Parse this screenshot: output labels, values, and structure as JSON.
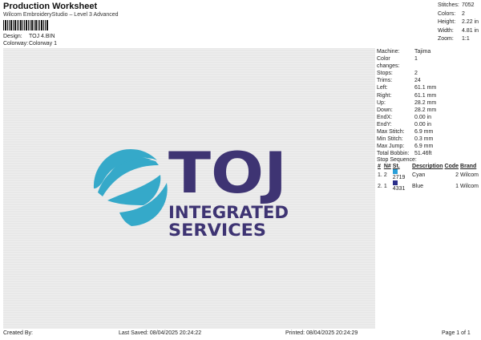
{
  "header": {
    "title": "Production Worksheet",
    "subtitle": "Wilcom EmbroideryStudio – Level 3 Advanced"
  },
  "design": {
    "label": "Design:",
    "value": "TOJ 4.BIN"
  },
  "colorway": {
    "label": "Colorway:",
    "value": "Colorway 1"
  },
  "top_stats": [
    {
      "label": "Stitches:",
      "value": "7052"
    },
    {
      "label": "Colors:",
      "value": "2"
    },
    {
      "label": "Height:",
      "value": "2.22 in"
    },
    {
      "label": "Width:",
      "value": "4.81 in"
    },
    {
      "label": "Zoom:",
      "value": "1:1"
    }
  ],
  "machine_info": [
    {
      "label": "Machine:",
      "value": "Tajima"
    },
    {
      "label": "Color changes:",
      "value": "1"
    },
    {
      "label": "Stops:",
      "value": "2"
    },
    {
      "label": "Trims:",
      "value": "24"
    },
    {
      "label": "Left:",
      "value": "61.1 mm"
    },
    {
      "label": "Right:",
      "value": "61.1 mm"
    },
    {
      "label": "Up:",
      "value": "28.2 mm"
    },
    {
      "label": "Down:",
      "value": "28.2 mm"
    },
    {
      "label": "EndX:",
      "value": "0.00 in"
    },
    {
      "label": "EndY:",
      "value": "0.00 in"
    },
    {
      "label": "Max Stitch:",
      "value": "6.9 mm"
    },
    {
      "label": "Min Stitch:",
      "value": "0.3 mm"
    },
    {
      "label": "Max Jump:",
      "value": "6.9 mm"
    },
    {
      "label": "Total Bobbin:",
      "value": "51.46ft"
    }
  ],
  "stop_sequence": {
    "title": "Stop Sequence:",
    "headers": [
      "#",
      "N#",
      "St.",
      "Description",
      "Code",
      "Brand"
    ],
    "rows": [
      {
        "num": "1.",
        "n": "2",
        "st": "2719",
        "description": "Cyan",
        "code": "2",
        "brand": "Wilcom",
        "color": "#2a9fd8"
      },
      {
        "num": "2.",
        "n": "1",
        "st": "4331",
        "description": "Blue",
        "code": "1",
        "brand": "Wilcom",
        "color": "#2b2f8a"
      }
    ]
  },
  "logo": {
    "main": "TOJ",
    "line1": "INTEGRATED",
    "line2": "SERVICES",
    "cyan": "#35a9c9",
    "purple": "#3e3473"
  },
  "footer": {
    "created": "Created By:",
    "saved": "Last Saved: 08/04/2025 20:24:22",
    "printed": "Printed: 08/04/2025 20:24:29",
    "page": "Page 1 of 1"
  }
}
